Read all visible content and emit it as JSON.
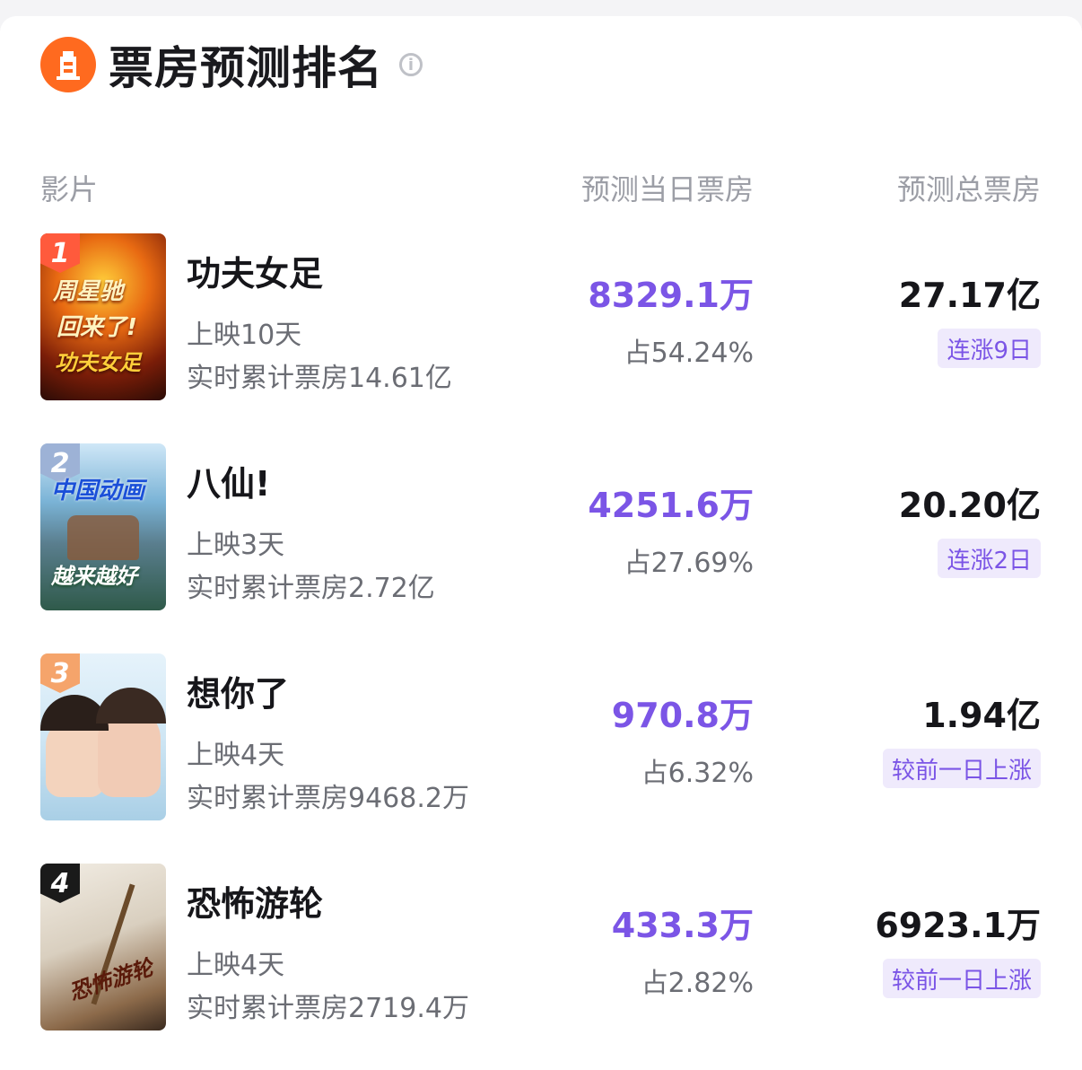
{
  "header": {
    "title": "票房预测排名",
    "info_icon": "info-icon",
    "logo_icon": "film-tower-logo"
  },
  "columns": {
    "film": "影片",
    "day": "预测当日票房",
    "total": "预测总票房"
  },
  "colors": {
    "accent": "#7b55e6",
    "logo": "#ff6a1f",
    "badge_bg": "#efeafc"
  },
  "films": [
    {
      "rank": "1",
      "name": "功夫女足",
      "days": "上映10天",
      "cumulative": "实时累计票房14.61亿",
      "day_box": "8329.1万",
      "share": "占54.24%",
      "total_box": "27.17亿",
      "trend": "连涨9日",
      "poster_text": [
        "周星驰",
        "回来了!",
        "功夫女足"
      ],
      "rank_color": "#ff5a3c"
    },
    {
      "rank": "2",
      "name": "八仙!",
      "days": "上映3天",
      "cumulative": "实时累计票房2.72亿",
      "day_box": "4251.6万",
      "share": "占27.69%",
      "total_box": "20.20亿",
      "trend": "连涨2日",
      "poster_text": [
        "中国动画",
        "越来越好"
      ],
      "rank_color": "#9db2d6"
    },
    {
      "rank": "3",
      "name": "想你了",
      "days": "上映4天",
      "cumulative": "实时累计票房9468.2万",
      "day_box": "970.8万",
      "share": "占6.32%",
      "total_box": "1.94亿",
      "trend": "较前一日上涨",
      "poster_text": [],
      "rank_color": "#f5a46b"
    },
    {
      "rank": "4",
      "name": "恐怖游轮",
      "days": "上映4天",
      "cumulative": "实时累计票房2719.4万",
      "day_box": "433.3万",
      "share": "占2.82%",
      "total_box": "6923.1万",
      "trend": "较前一日上涨",
      "poster_text": [
        "恐怖游轮"
      ],
      "rank_color": "#1a1a1a"
    }
  ]
}
